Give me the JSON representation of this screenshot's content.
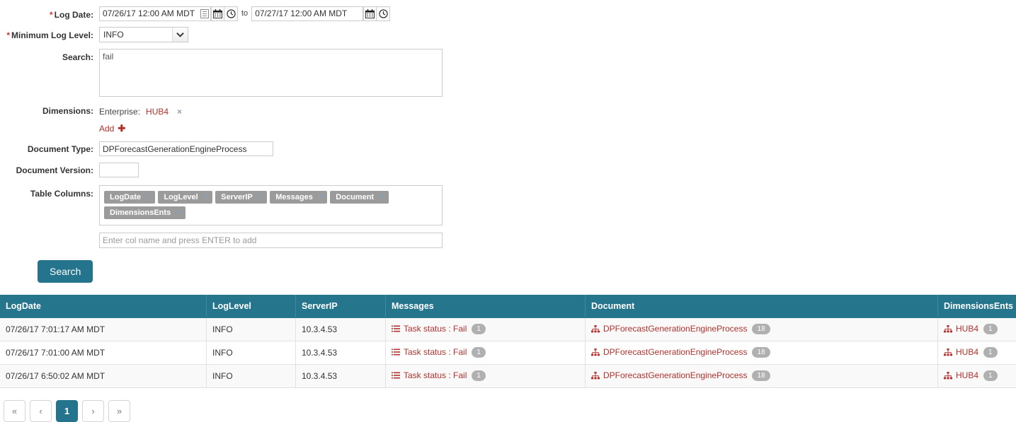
{
  "form": {
    "log_date": {
      "label": "Log Date:",
      "required": true,
      "from_value": "07/26/17 12:00 AM MDT",
      "to_label": "to",
      "to_value": "07/27/17 12:00 AM MDT",
      "icons": [
        "spinner-icon",
        "calendar-icon",
        "clock-icon"
      ]
    },
    "min_log_level": {
      "label": "Minimum Log Level:",
      "required": true,
      "value": "INFO",
      "options": [
        "INFO"
      ]
    },
    "search": {
      "label": "Search:",
      "value": "fail"
    },
    "dimensions": {
      "label": "Dimensions:",
      "entries": [
        {
          "key": "Enterprise:",
          "value": "HUB4",
          "remove": "×"
        }
      ],
      "add_label": "Add",
      "add_icon": "plus-icon"
    },
    "document_type": {
      "label": "Document Type:",
      "value": "DPForecastGenerationEngineProcess"
    },
    "document_version": {
      "label": "Document Version:",
      "value": ""
    },
    "table_columns": {
      "label": "Table Columns:",
      "chips": [
        "LogDate",
        "LogLevel",
        "ServerIP",
        "Messages",
        "Document",
        "DimensionsEnts"
      ],
      "chip_remove": "×",
      "add_placeholder": "Enter col name and press ENTER to add",
      "add_value": ""
    },
    "submit_label": "Search"
  },
  "results": {
    "columns": [
      "LogDate",
      "LogLevel",
      "ServerIP",
      "Messages",
      "Document",
      "DimensionsEnts"
    ],
    "rows": [
      {
        "logdate": "07/26/17 7:01:17 AM MDT",
        "loglevel": "INFO",
        "serverip": "10.3.4.53",
        "messages_text": "Task status : Fail",
        "messages_count": "1",
        "document_text": "DPForecastGenerationEngineProcess",
        "document_count": "18",
        "dimensions_text": "HUB4",
        "dimensions_count": "1"
      },
      {
        "logdate": "07/26/17 7:01:00 AM MDT",
        "loglevel": "INFO",
        "serverip": "10.3.4.53",
        "messages_text": "Task status : Fail",
        "messages_count": "1",
        "document_text": "DPForecastGenerationEngineProcess",
        "document_count": "18",
        "dimensions_text": "HUB4",
        "dimensions_count": "1"
      },
      {
        "logdate": "07/26/17 6:50:02 AM MDT",
        "loglevel": "INFO",
        "serverip": "10.3.4.53",
        "messages_text": "Task status : Fail",
        "messages_count": "1",
        "document_text": "DPForecastGenerationEngineProcess",
        "document_count": "18",
        "dimensions_text": "HUB4",
        "dimensions_count": "1"
      }
    ]
  },
  "pagination": {
    "first": "«",
    "prev": "‹",
    "pages": [
      "1"
    ],
    "current_page": "1",
    "next": "›",
    "last": "»"
  },
  "colors": {
    "accent_teal": "#23748c",
    "table_header": "#25768d",
    "link_red": "#b2312c",
    "required_red": "#d9362b",
    "chip_gray": "#9b9b9b",
    "badge_gray": "#b0b0b0"
  }
}
